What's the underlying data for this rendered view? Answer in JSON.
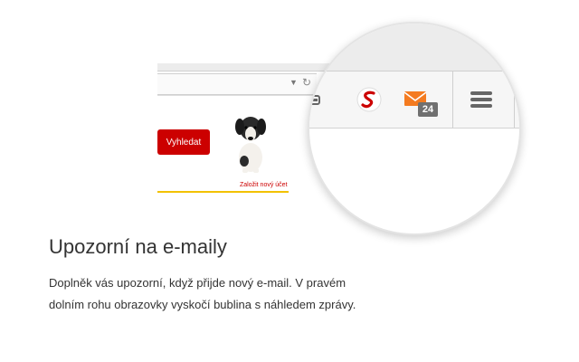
{
  "illustration": {
    "browser": {
      "search_button_label": "Vyhledat",
      "signup_link": "Založit nový účet",
      "dropdown_icon": "chevron-down-icon",
      "reload_icon": "reload-icon"
    },
    "magnifier": {
      "extension_icon": "seznam-s-icon",
      "mail_icon": "envelope-icon",
      "mail_badge_count": "24",
      "menu_icon": "hamburger-menu-icon"
    }
  },
  "feature": {
    "title": "Upozorní na e-maily",
    "description_line1": "Doplněk vás upozorní, když přijde nový e-mail. V pravém",
    "description_line2": "dolním rohu obrazovky vyskočí bublina s náhledem zprávy."
  },
  "colors": {
    "accent_red": "#cc0000",
    "mail_orange": "#f47b20",
    "badge_gray": "#707070",
    "divider_yellow": "#f2c200",
    "text": "#333333"
  }
}
